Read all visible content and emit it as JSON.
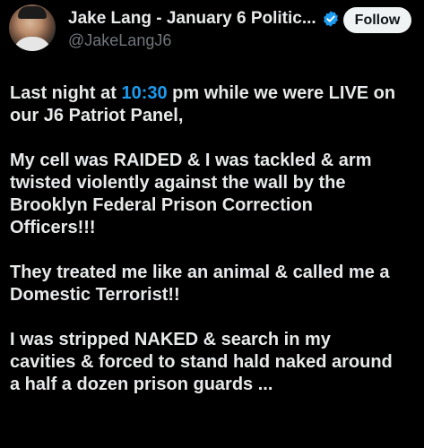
{
  "author": {
    "display_name": "Jake Lang - January 6 Politic...",
    "handle": "@JakeLangJ6",
    "avatar_icon": "profile-photo",
    "verified_icon": "verified-badge-icon",
    "verified_color": "#1d9bf0"
  },
  "follow_button": {
    "label": "Follow"
  },
  "tweet": {
    "p1_l1_before": "Last night at ",
    "p1_l1_link": "10:30",
    "p1_l1_after": " pm while we were LIVE on",
    "p1_l2": "our J6 Patriot Panel,",
    "p2_l1": "My cell was RAIDED & I was tackled & arm",
    "p2_l2": "twisted violently against the wall by the",
    "p2_l3": "Brooklyn Federal Prison Correction",
    "p2_l4": "Officers!!!",
    "p3_l1": "They treated me like an animal & called me a",
    "p3_l2": "Domestic Terrorist!!",
    "p4_l1": "I was stripped NAKED & search in my",
    "p4_l2": "cavities & forced to stand hald naked around",
    "p4_l3": "a half a dozen prison guards ..."
  },
  "colors": {
    "background": "#000000",
    "text": "#e7e9ea",
    "secondary_text": "#71767b",
    "link": "#1d9bf0",
    "button_bg": "#eff3f4",
    "button_text": "#0f1419"
  }
}
